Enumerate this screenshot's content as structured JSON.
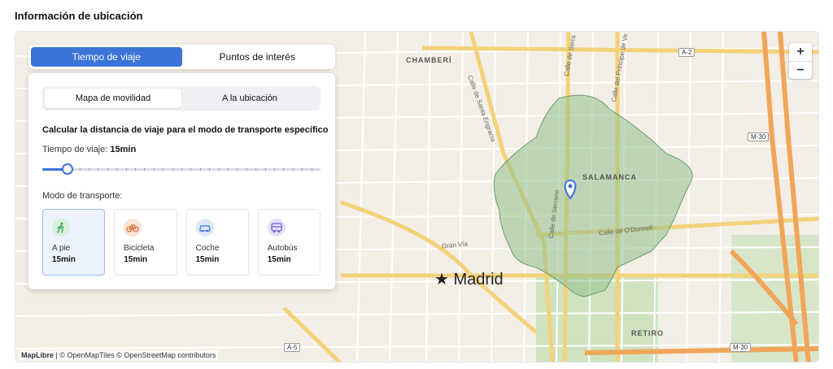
{
  "section": {
    "title": "Información de ubicación"
  },
  "map": {
    "zoom_in": "+",
    "zoom_out": "−",
    "attribution_brand": "MapLibre",
    "attribution_rest": " | © OpenMapTiles © OpenStreetMap contributors",
    "labels": {
      "chamberi": "CHAMBERÍ",
      "salamanca": "SALAMANCA",
      "retiro": "RETIRO",
      "madrid": "Madrid",
      "gran_via": "Gran Vía",
      "calle_odonnell": "Calle de O'Donnell",
      "calle_serrano": "Calle de Serrano",
      "santa_engracia": "Calle de Santa Engracia",
      "principe_vergara": "Calle del Príncipe de Ve",
      "serrano_top": "Calle de Serra"
    },
    "shields": {
      "a2": "A-2",
      "m30_top": "M-30",
      "m30_bottom": "M-30",
      "a5": "A-5"
    },
    "colors": {
      "isochrone_fill": "#8fbf8a",
      "isochrone_stroke": "#6a9e6a",
      "pin": "#3b73d9"
    }
  },
  "panel": {
    "tabs": [
      {
        "label": "Tiempo de viaje",
        "active": true
      },
      {
        "label": "Puntos de interés",
        "active": false
      }
    ],
    "segments": [
      {
        "label": "Mapa de movilidad",
        "active": true
      },
      {
        "label": "A la ubicación",
        "active": false
      }
    ],
    "calc_title": "Calcular la distancia de viaje para el modo de transporte específico",
    "time_label": "Tiempo de viaje:",
    "time_value": "15min",
    "slider_fraction": 0.09,
    "mode_label": "Modo de transporte:",
    "modes": [
      {
        "name": "A pie",
        "duration": "15min",
        "icon": "walking-icon",
        "color": "#3aa657",
        "bg": "#d8f0dc",
        "active": true
      },
      {
        "name": "Bicicleta",
        "duration": "15min",
        "icon": "bicycle-icon",
        "color": "#e06a2c",
        "bg": "#fbe3d6",
        "active": false
      },
      {
        "name": "Coche",
        "duration": "15min",
        "icon": "car-icon",
        "color": "#3b73d9",
        "bg": "#dce7fa",
        "active": false
      },
      {
        "name": "Autobús",
        "duration": "15min",
        "icon": "bus-icon",
        "color": "#6a5bd6",
        "bg": "#e3e0fa",
        "active": false
      }
    ]
  }
}
